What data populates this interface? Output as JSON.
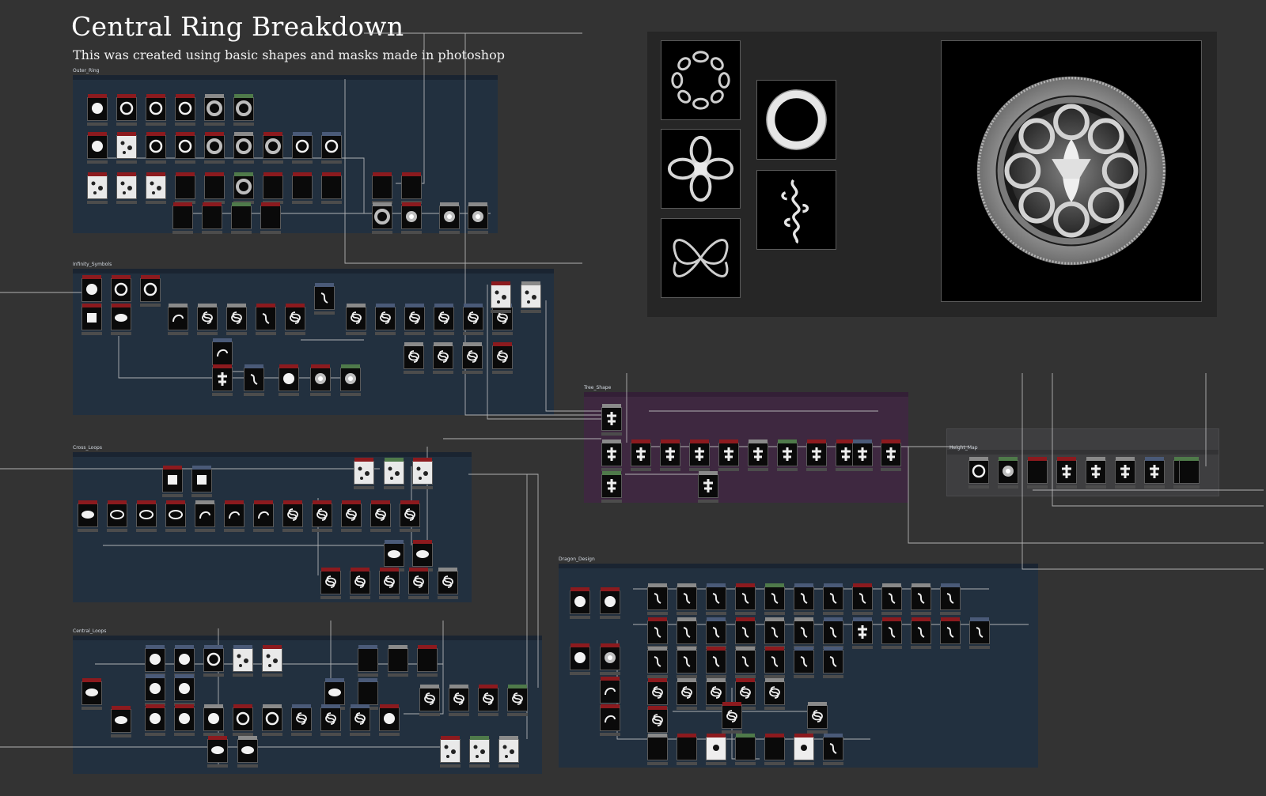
{
  "header": {
    "title": "Central Ring Breakdown",
    "subtitle": "This was created using basic shapes and masks made in photoshop"
  },
  "frames": [
    {
      "id": "outer",
      "label": "Outer_Ring",
      "theme": "blue"
    },
    {
      "id": "infinity",
      "label": "Infinity_Symbols",
      "theme": "blue"
    },
    {
      "id": "cross",
      "label": "Cross_Loops",
      "theme": "blue"
    },
    {
      "id": "central",
      "label": "Central_Loops",
      "theme": "blue"
    },
    {
      "id": "tree",
      "label": "Tree_Shape",
      "theme": "purple"
    },
    {
      "id": "height",
      "label": "Height_Map",
      "theme": "gray"
    },
    {
      "id": "dragon",
      "label": "Dragon_Design",
      "theme": "blue"
    }
  ],
  "preview": {
    "thumbnails": [
      "infinity-ring-mask",
      "cross-loop-mask",
      "bow-loop-mask",
      "outer-ring-mask",
      "dragon-mask"
    ],
    "final_render": "central-ring-heightmap"
  },
  "colors": {
    "background": "#333333",
    "frame_blue": "#22303f",
    "frame_purple": "#3e2840",
    "header_red": "#8c1a1e",
    "header_gray": "#8a8a8a",
    "header_green": "#4f7a4a",
    "header_slate": "#4a5a78",
    "wire": "#c8c8c8"
  }
}
